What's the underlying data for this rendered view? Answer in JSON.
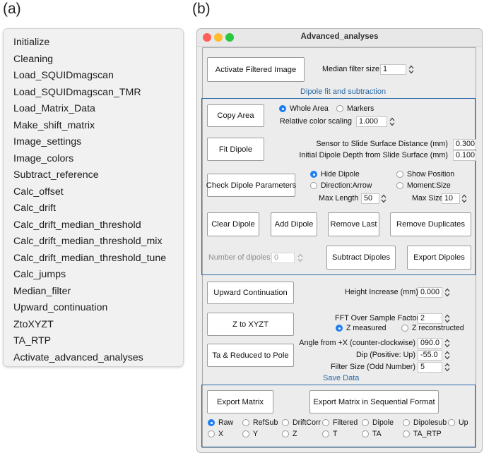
{
  "panel_a": {
    "label": "(a)",
    "menu_items": [
      "Initialize",
      "Cleaning",
      "Load_SQUIDmagscan",
      "Load_SQUIDmagscan_TMR",
      "Load_Matrix_Data",
      "Make_shift_matrix",
      "Image_settings",
      "Image_colors",
      "Subtract_reference",
      "Calc_offset",
      "Calc_drift",
      "Calc_drift_median_threshold",
      "Calc_drift_median_threshold_mix",
      "Calc_drift_median_threshold_tune",
      "Calc_jumps",
      "Median_filter",
      "Upward_continuation",
      "ZtoXYZT",
      "TA_RTP",
      "Activate_advanced_analyses"
    ]
  },
  "panel_b": {
    "label": "(b)",
    "window_title": "Advanced_analyses",
    "traffic_lights": {
      "close": "#fe5f57",
      "minimize": "#febc2e",
      "zoom": "#28c840"
    },
    "accent_color": "#2a6aa6",
    "filter": {
      "button": "Activate Filtered Image",
      "label": "Median filter size",
      "value": "1"
    },
    "dipole": {
      "group_title": "Dipole fit and subtraction",
      "copy_area": "Copy Area",
      "whole_area": "Whole Area",
      "markers": "Markers",
      "color_scaling_label": "Relative color scaling",
      "color_scaling_value": "1.000",
      "fit_dipole": "Fit Dipole",
      "sensor_dist_label": "Sensor to Slide Surface Distance (mm)",
      "sensor_dist_value": "0.300",
      "init_depth_label": "Initial Dipole Depth from Slide Surface (mm)",
      "init_depth_value": "0.100",
      "check_params": "Check Dipole Parameters",
      "hide_dipole": "Hide Dipole",
      "show_position": "Show Position",
      "direction_arrow": "Direction:Arrow",
      "moment_size": "Moment:Size",
      "max_length_label": "Max Length",
      "max_length_value": "50",
      "max_size_label": "Max Size",
      "max_size_value": "10",
      "clear_dipole": "Clear Dipole",
      "add_dipole": "Add Dipole",
      "remove_last": "Remove Last",
      "remove_duplicates": "Remove Duplicates",
      "num_dipoles_label": "Number of dipoles",
      "num_dipoles_value": "0",
      "subtract_dipoles": "Subtract Dipoles",
      "export_dipoles": "Export Dipoles"
    },
    "upward": {
      "button": "Upward Continuation",
      "label": "Height Increase (mm)",
      "value": "0.000"
    },
    "ztoxyzt": {
      "button": "Z to XYZT",
      "fft_label": "FFT Over Sample Factor",
      "fft_value": "2",
      "z_measured": "Z measured",
      "z_reconstructed": "Z reconstructed"
    },
    "ta": {
      "button": "Ta & Reduced to Pole",
      "angle_label": "Angle from +X (counter-clockwise)",
      "angle_value": "090.0",
      "dip_label": "Dip (Positive: Up)",
      "dip_value": "-55.0",
      "filter_label": "Filter Size (Odd Number)",
      "filter_value": "5"
    },
    "save": {
      "group_title": "Save Data",
      "export_matrix": "Export Matrix",
      "export_sequential": "Export Matrix in Sequential Format",
      "options_row1": [
        "Raw",
        "RefSub",
        "DriftCorr",
        "Filtered",
        "Dipole",
        "Dipolesub",
        "Up"
      ],
      "options_row2": [
        "X",
        "Y",
        "Z",
        "T",
        "TA",
        "TA_RTP"
      ],
      "selected": "Raw"
    }
  }
}
